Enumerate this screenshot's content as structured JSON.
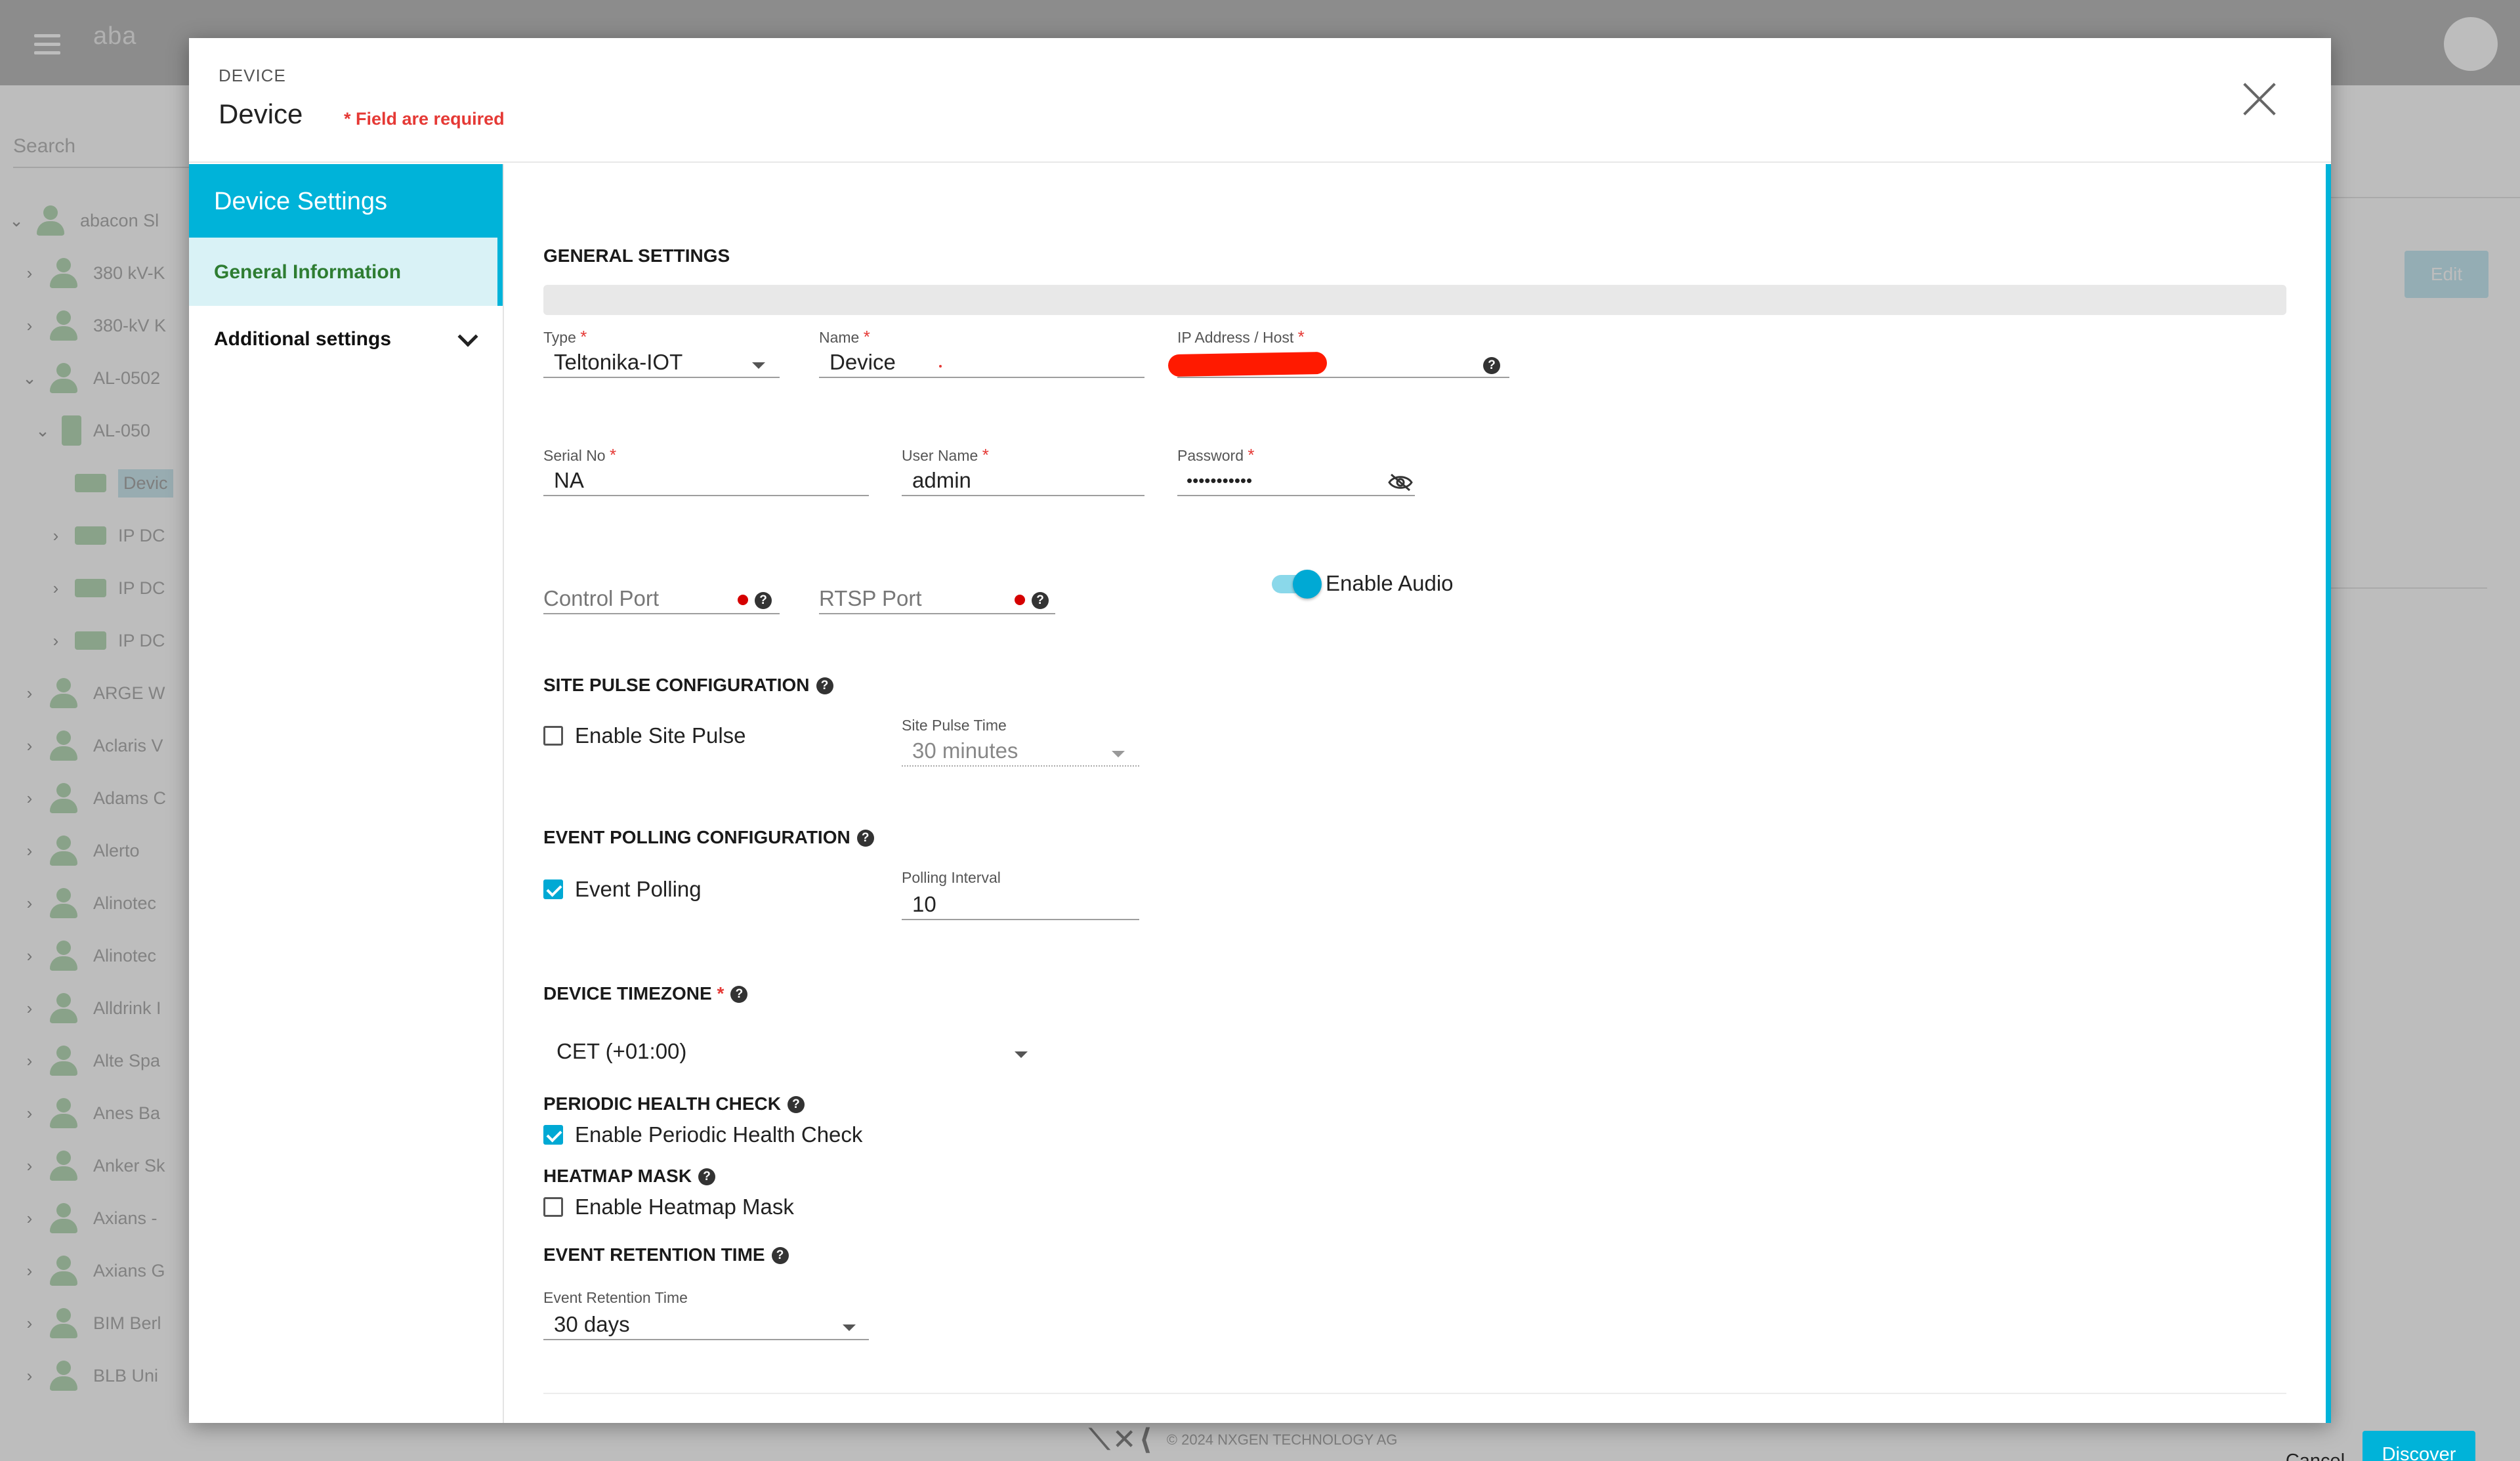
{
  "background": {
    "logo": "aba",
    "search_placeholder": "Search",
    "tree": [
      {
        "label": "abacon Sl",
        "chev": "v",
        "icon": "person"
      },
      {
        "label": "380 kV-K",
        "chev": ">",
        "icon": "person"
      },
      {
        "label": "380-kV K",
        "chev": ">",
        "icon": "person"
      },
      {
        "label": "AL-0502",
        "chev": "v",
        "icon": "person"
      },
      {
        "label": "AL-050",
        "chev": "v",
        "icon": "building"
      },
      {
        "label": "Devic",
        "chev": "",
        "icon": "device"
      },
      {
        "label": "IP DC",
        "chev": ">",
        "icon": "device"
      },
      {
        "label": "IP DC",
        "chev": ">",
        "icon": "device"
      },
      {
        "label": "IP DC",
        "chev": ">",
        "icon": "device"
      },
      {
        "label": "ARGE W",
        "chev": ">",
        "icon": "person"
      },
      {
        "label": "Aclaris V",
        "chev": ">",
        "icon": "person"
      },
      {
        "label": "Adams C",
        "chev": ">",
        "icon": "person"
      },
      {
        "label": "Alerto",
        "chev": ">",
        "icon": "person"
      },
      {
        "label": "Alinotec",
        "chev": ">",
        "icon": "person"
      },
      {
        "label": "Alinotec",
        "chev": ">",
        "icon": "person"
      },
      {
        "label": "Alldrink I",
        "chev": ">",
        "icon": "person"
      },
      {
        "label": "Alte Spa",
        "chev": ">",
        "icon": "person"
      },
      {
        "label": "Anes Ba",
        "chev": ">",
        "icon": "person"
      },
      {
        "label": "Anker Sk",
        "chev": ">",
        "icon": "person"
      },
      {
        "label": "Axians -",
        "chev": ">",
        "icon": "person"
      },
      {
        "label": "Axians G",
        "chev": ">",
        "icon": "person"
      },
      {
        "label": "BIM Berl",
        "chev": ">",
        "icon": "person"
      },
      {
        "label": "BLB Uni",
        "chev": ">",
        "icon": "person"
      }
    ],
    "edit_label": "Edit",
    "footer_copy": "© 2024 NXGEN TECHNOLOGY AG"
  },
  "dialog": {
    "kicker": "DEVICE",
    "title": "Device",
    "required_note": "* Field are required",
    "sidebar": {
      "header": "Device Settings",
      "general": "General Information",
      "additional": "Additional settings"
    },
    "general_settings": {
      "heading": "GENERAL SETTINGS",
      "type_label": "Type",
      "type_value": "Teltonika-IOT",
      "name_label": "Name",
      "name_value": "Device",
      "ip_label": "IP Address / Host",
      "serial_label": "Serial No",
      "serial_value": "NA",
      "username_label": "User Name",
      "username_value": "admin",
      "password_label": "Password",
      "password_value": "•••••••••••",
      "control_port_placeholder": "Control Port",
      "rtsp_port_placeholder": "RTSP Port",
      "enable_audio": "Enable Audio",
      "enable_audio_on": true
    },
    "site_pulse": {
      "heading": "SITE PULSE CONFIGURATION",
      "enable_label": "Enable Site Pulse",
      "enabled": false,
      "time_label": "Site Pulse Time",
      "time_value": "30 minutes"
    },
    "event_polling": {
      "heading": "EVENT POLLING CONFIGURATION",
      "enable_label": "Event Polling",
      "enabled": true,
      "interval_label": "Polling Interval",
      "interval_value": "10"
    },
    "timezone": {
      "heading": "DEVICE TIMEZONE",
      "value": "CET (+01:00)"
    },
    "health_check": {
      "heading": "PERIODIC HEALTH CHECK",
      "enable_label": "Enable Periodic Health Check",
      "enabled": true
    },
    "heatmap": {
      "heading": "HEATMAP MASK",
      "enable_label": "Enable Heatmap Mask",
      "enabled": false
    },
    "retention": {
      "heading": "EVENT RETENTION TIME",
      "label": "Event Retention Time",
      "value": "30 days"
    },
    "buttons": {
      "cancel": "Cancel",
      "discover": "Discover"
    },
    "colors": {
      "accent": "#00b3d9",
      "required": "#e53935",
      "active_nav_text": "#2e7d32"
    }
  }
}
